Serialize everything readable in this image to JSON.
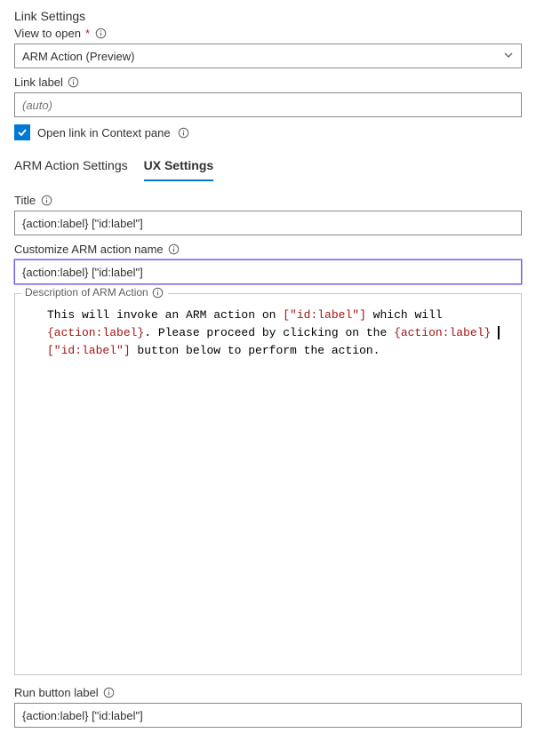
{
  "header": {
    "title": "Link Settings"
  },
  "view_to_open": {
    "label": "View to open",
    "required_star": "*",
    "value": "ARM Action (Preview)"
  },
  "link_label": {
    "label": "Link label",
    "placeholder": "(auto)"
  },
  "open_in_context": {
    "label": "Open link in Context pane",
    "checked": true
  },
  "tabs": {
    "arm_settings": "ARM Action Settings",
    "ux_settings": "UX Settings"
  },
  "title_field": {
    "label": "Title",
    "value": "{action:label} [\"id:label\"]"
  },
  "customize_name": {
    "label": "Customize ARM action name",
    "value": "{action:label} [\"id:label\"]"
  },
  "description": {
    "label": "Description of ARM Action",
    "text_parts": {
      "p1": "This will invoke an ARM action on ",
      "id1": "[\"id:label\"]",
      "p2": " which will ",
      "act1": "{action:label}",
      "p3": ". Please proceed by clicking on the ",
      "act2": "{action:label}",
      "sp1": " ",
      "id2": "[\"id:label\"]",
      "p4": " button below to perform the action."
    }
  },
  "run_button": {
    "label": "Run button label",
    "value": "{action:label} [\"id:label\"]"
  }
}
